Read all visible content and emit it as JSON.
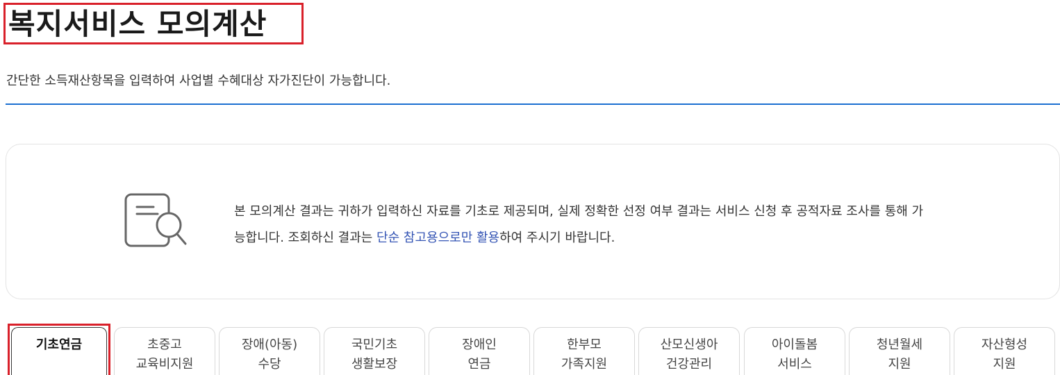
{
  "header": {
    "title": "복지서비스 모의계산",
    "subtitle": "간단한 소득재산항목을 입력하여 사업별 수혜대상 자가진단이 가능합니다."
  },
  "notice": {
    "icon": "document-search-icon",
    "line1": "본 모의계산 결과는 귀하가 입력하신 자료를 기초로 제공되며, 실제 정확한 선정 여부 결과는 서비스 신청 후 공적자료 조사를 통해 가",
    "line2_prefix": "능합니다. 조회하신 결과는 ",
    "line2_highlight": "단순 참고용으로만 활용",
    "line2_suffix": "하여 주시기 바랍니다.",
    "highlight_color": "#3454b4"
  },
  "tabs": [
    {
      "line1": "기초연금",
      "line2": "",
      "active": true
    },
    {
      "line1": "초중고",
      "line2": "교육비지원",
      "active": false
    },
    {
      "line1": "장애(아동)",
      "line2": "수당",
      "active": false
    },
    {
      "line1": "국민기초",
      "line2": "생활보장",
      "active": false
    },
    {
      "line1": "장애인",
      "line2": "연금",
      "active": false
    },
    {
      "line1": "한부모",
      "line2": "가족지원",
      "active": false
    },
    {
      "line1": "산모신생아",
      "line2": "건강관리",
      "active": false
    },
    {
      "line1": "아이돌봄",
      "line2": "서비스",
      "active": false
    },
    {
      "line1": "청년월세",
      "line2": "지원",
      "active": false
    },
    {
      "line1": "자산형성",
      "line2": "지원",
      "active": false
    }
  ],
  "colors": {
    "accent_red": "#d9202a",
    "accent_blue": "#1a6fd1"
  }
}
